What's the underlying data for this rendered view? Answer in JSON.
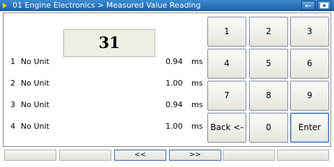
{
  "window": {
    "title": "01 Engine Electronics > Measured Value Reading",
    "back_icon": "arrow-left-icon",
    "camera_icon": "camera-icon"
  },
  "display": {
    "value": "31"
  },
  "measurements": [
    {
      "index": "1",
      "label": "No Unit",
      "value": "0.94",
      "unit": "ms"
    },
    {
      "index": "2",
      "label": "No Unit",
      "value": "1.00",
      "unit": "ms"
    },
    {
      "index": "3",
      "label": "No Unit",
      "value": "0.94",
      "unit": "ms"
    },
    {
      "index": "4",
      "label": "No Unit",
      "value": "1.00",
      "unit": "ms"
    }
  ],
  "keypad": {
    "k1": "1",
    "k2": "2",
    "k3": "3",
    "k4": "4",
    "k5": "5",
    "k6": "6",
    "k7": "7",
    "k8": "8",
    "k9": "9",
    "back": "Back <-",
    "k0": "0",
    "enter": "Enter"
  },
  "bottom_bar": {
    "b1": "",
    "b2": "",
    "prev": "<<",
    "next": ">>",
    "b5": "",
    "b6": ""
  }
}
